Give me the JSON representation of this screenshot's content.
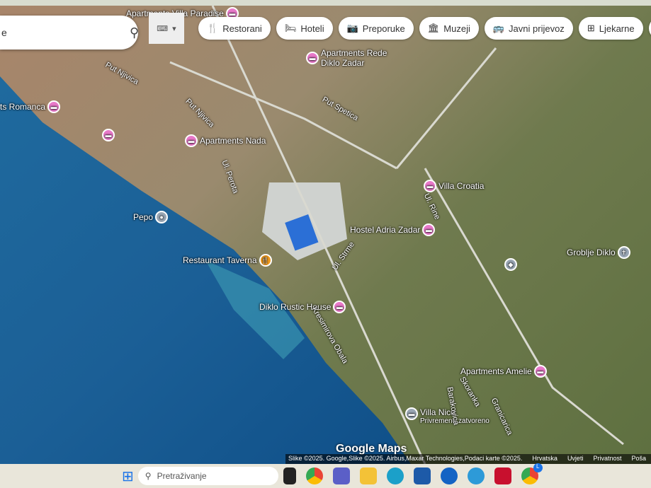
{
  "search": {
    "value": "e",
    "placeholder": ""
  },
  "chips": [
    {
      "label": "Restorani",
      "icon": "fork-knife-icon"
    },
    {
      "label": "Hoteli",
      "icon": "bed-icon"
    },
    {
      "label": "Preporuke",
      "icon": "camera-icon"
    },
    {
      "label": "Muzeji",
      "icon": "museum-icon"
    },
    {
      "label": "Javni prijevoz",
      "icon": "bus-icon"
    },
    {
      "label": "Ljekarne",
      "icon": "pharmacy-icon"
    }
  ],
  "places": {
    "villa_paradise": "Apartments Villa Paradise",
    "rede": "Apartments Rede\nDiklo Zadar",
    "romanca": "ts Romanca",
    "nada": "Apartments Nada",
    "villa_croatia": "Villa Croatia",
    "pepo": "Pepo",
    "hostel": "Hostel Adria Zadar",
    "groblje": "Groblje Diklo",
    "taverna": "Restaurant Taverna",
    "rustic": "Diklo Rustic House",
    "amelie": "Apartments Amelie",
    "nico": "Villa Nico",
    "nico_status": "Privremeno zatvoreno"
  },
  "roads": [
    "Put Njivica",
    "Put Njivica",
    "Put Spetica",
    "Ul. Perota",
    "Ul. Rine",
    "Ul. Strme",
    "Kresimirova Obala",
    "Barakovica",
    "Skoranka",
    "Granicarica"
  ],
  "footer": {
    "brand": "Google Maps",
    "attribution": "Slike ©2025. Google,Slike ©2025. Airbus,Maxar Technologies,Podaci karte ©2025.",
    "links": [
      "Hrvatska",
      "Uvjeti",
      "Privatnost",
      "Poša"
    ]
  },
  "taskbar": {
    "search_placeholder": "Pretraživanje",
    "badge": "L"
  }
}
